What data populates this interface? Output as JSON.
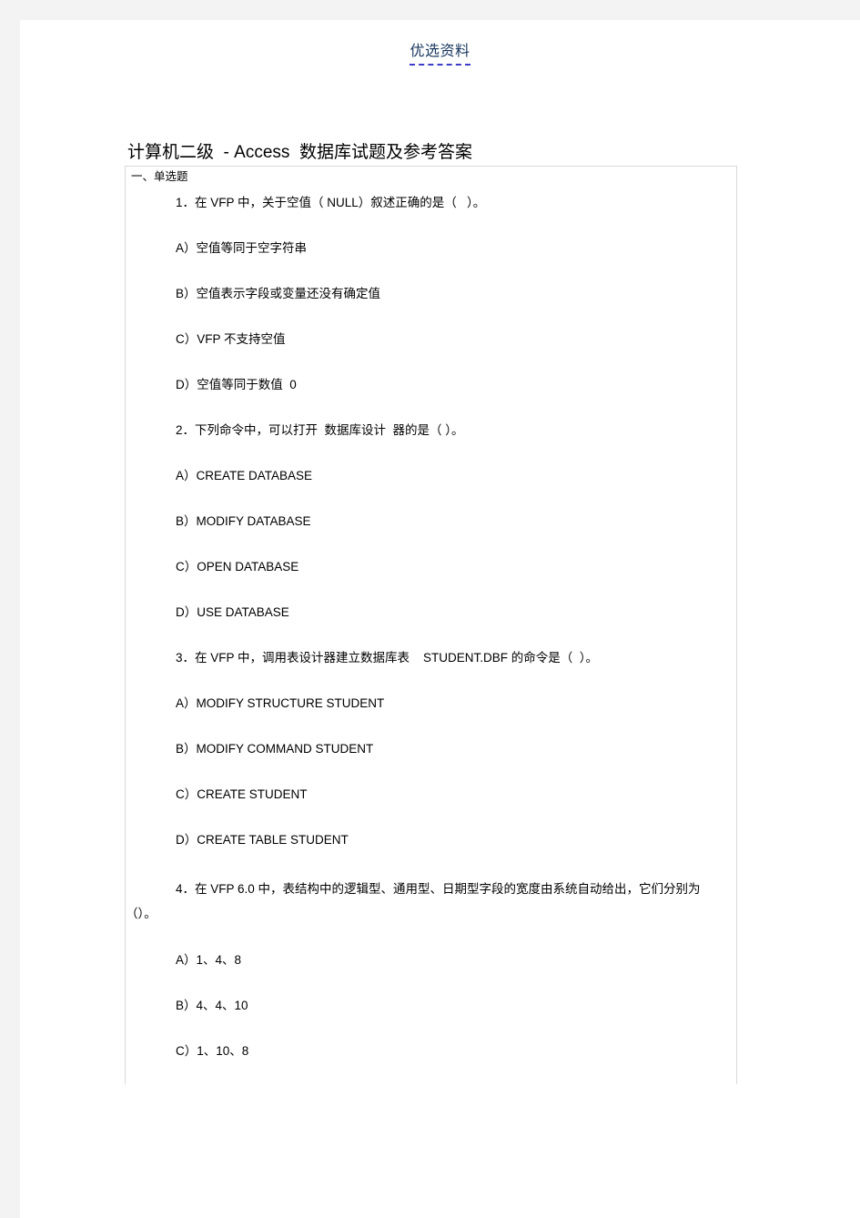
{
  "header": {
    "watermark_text": "优选资料",
    "underline_color": "#3c3cc8",
    "text_color": "#17365d"
  },
  "document": {
    "title": "计算机二级  - Access  数据库试题及参考答案",
    "section_label": "一、单选题"
  },
  "questions": [
    {
      "stem": "1．在 VFP 中，关于空值（ NULL）叙述正确的是（   ）。",
      "options": [
        "A）空值等同于空字符串",
        "B）空值表示字段或变量还没有确定值",
        "C）VFP 不支持空值",
        "D）空值等同于数值  0"
      ]
    },
    {
      "stem": "2．下列命令中，可以打开  数据库设计  器的是（ ）。",
      "options": [
        "A）CREATE DATABASE",
        "B）MODIFY DATABASE",
        "C）OPEN DATABASE",
        "D）USE DATABASE"
      ]
    },
    {
      "stem": "3．在 VFP 中，调用表设计器建立数据库表    STUDENT.DBF 的命令是（  ）。",
      "options": [
        "A）MODIFY STRUCTURE STUDENT",
        "B）MODIFY COMMAND STUDENT",
        "C）CREATE STUDENT",
        "D）CREATE TABLE STUDENT"
      ]
    },
    {
      "stem": "4．在 VFP 6.0 中，表结构中的逻辑型、通用型、日期型字段的宽度由系统自动给出，它们分别为（）。",
      "stem_wraps": true,
      "options": [
        "A）1、4、8",
        "B）4、4、10",
        "C）1、10、8"
      ]
    }
  ]
}
